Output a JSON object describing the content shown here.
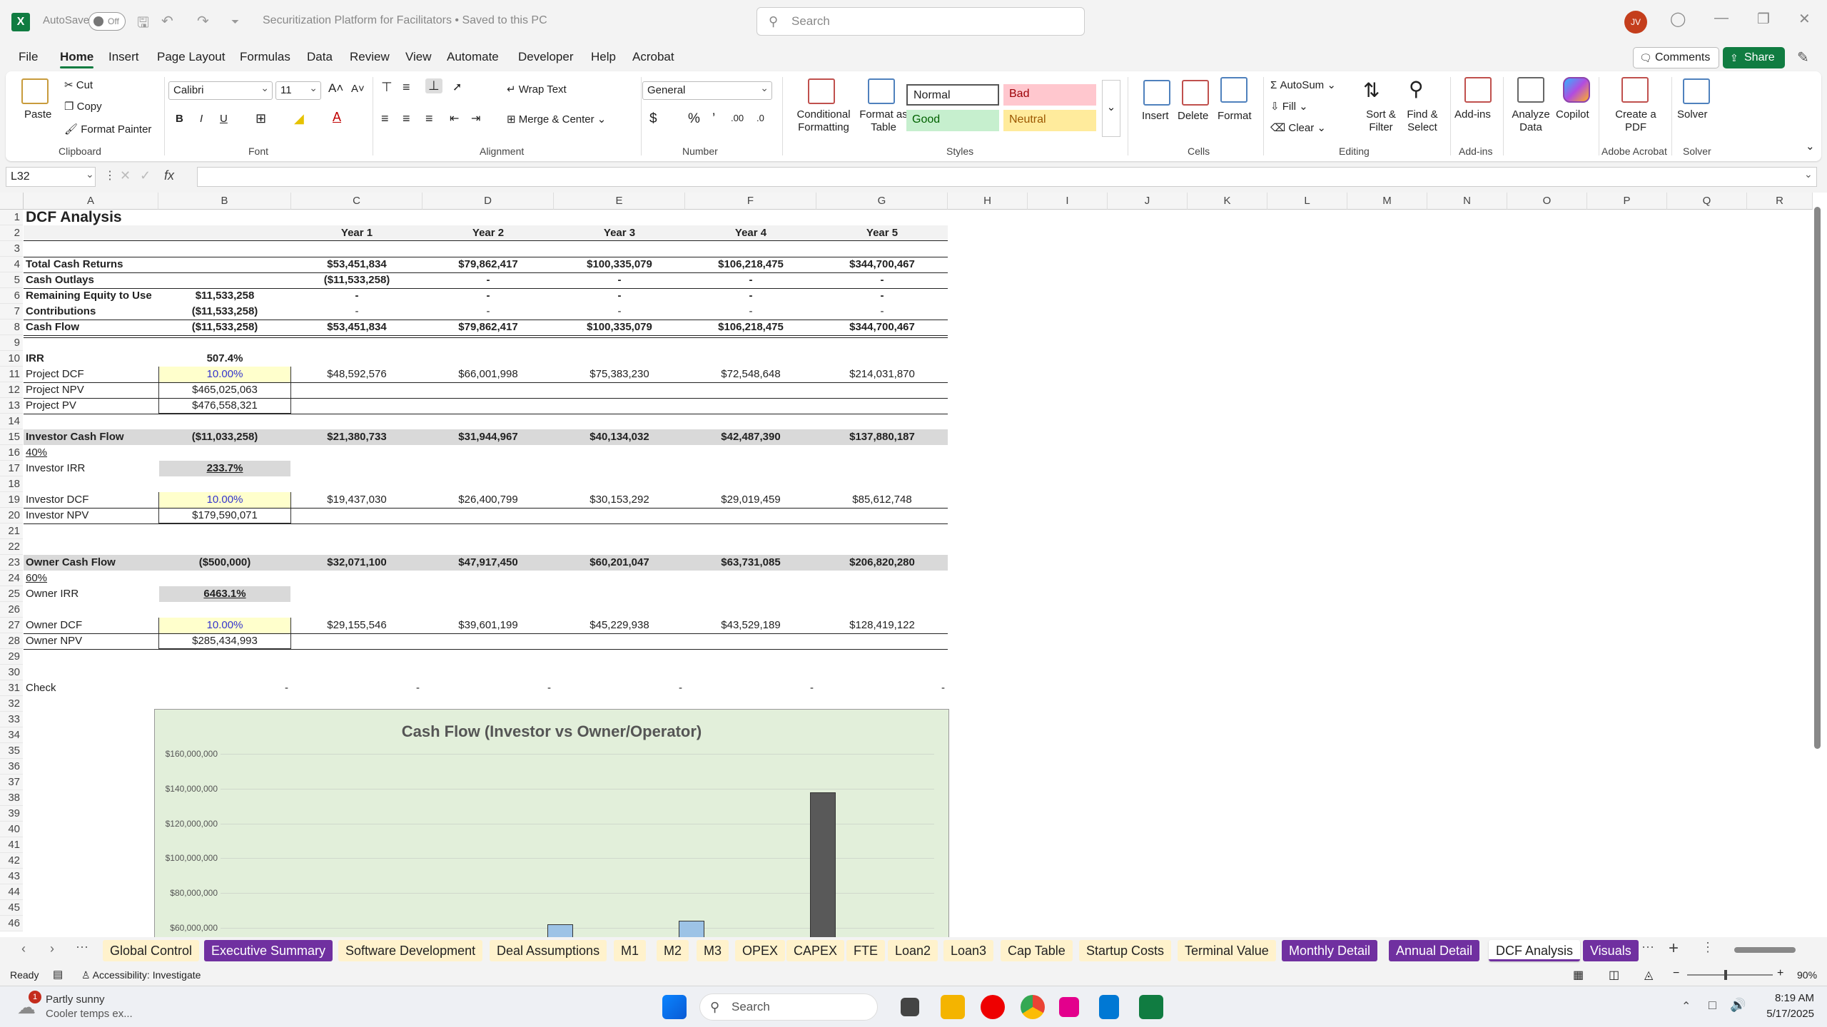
{
  "titlebar": {
    "autosave_label": "AutoSave",
    "autosave_state": "Off",
    "doc_title": "Securitization Platform for Facilitators • Saved to this PC",
    "search_placeholder": "Search",
    "user_initials": "JV"
  },
  "menu": {
    "tabs": [
      "File",
      "Home",
      "Insert",
      "Page Layout",
      "Formulas",
      "Data",
      "Review",
      "View",
      "Automate",
      "Developer",
      "Help",
      "Acrobat"
    ],
    "comments": "Comments",
    "share": "Share"
  },
  "ribbon": {
    "clipboard": {
      "paste": "Paste",
      "cut": "Cut",
      "copy": "Copy",
      "format_painter": "Format Painter",
      "group": "Clipboard"
    },
    "font": {
      "name": "Calibri",
      "size": "11",
      "group": "Font"
    },
    "alignment": {
      "wrap_text": "Wrap Text",
      "merge_center": "Merge & Center",
      "group": "Alignment"
    },
    "number": {
      "format": "General",
      "group": "Number"
    },
    "styles": {
      "conditional": "Conditional Formatting",
      "format_table": "Format as Table",
      "normal": "Normal",
      "bad": "Bad",
      "good": "Good",
      "neutral": "Neutral",
      "group": "Styles"
    },
    "cells": {
      "insert": "Insert",
      "delete": "Delete",
      "format": "Format",
      "group": "Cells"
    },
    "editing": {
      "autosum": "AutoSum",
      "fill": "Fill",
      "clear": "Clear",
      "sort_filter": "Sort & Filter",
      "find_select": "Find & Select",
      "group": "Editing"
    },
    "addins": {
      "addins": "Add-ins",
      "group": "Add-ins"
    },
    "analyze": {
      "label": "Analyze Data"
    },
    "copilot": {
      "label": "Copilot"
    },
    "acrobat": {
      "create_pdf": "Create a PDF",
      "group": "Adobe Acrobat"
    },
    "solver": {
      "label": "Solver",
      "group": "Solver"
    }
  },
  "formula_bar": {
    "name_box": "L32",
    "fx": "fx",
    "formula": ""
  },
  "columns": [
    "A",
    "B",
    "C",
    "D",
    "E",
    "F",
    "G",
    "H",
    "I",
    "J",
    "K",
    "L",
    "M",
    "N",
    "O",
    "P",
    "Q",
    "R"
  ],
  "rows": [
    "1",
    "2",
    "3",
    "4",
    "5",
    "6",
    "7",
    "8",
    "9",
    "10",
    "11",
    "12",
    "13",
    "14",
    "15",
    "16",
    "17",
    "18",
    "19",
    "20",
    "21",
    "22",
    "23",
    "24",
    "25",
    "26",
    "27",
    "28",
    "29",
    "30",
    "31",
    "32",
    "33",
    "34",
    "35",
    "36",
    "37",
    "38",
    "39",
    "40",
    "41",
    "42",
    "43",
    "44",
    "45",
    "46"
  ],
  "sheet": {
    "title": "DCF Analysis",
    "years": [
      "Year 1",
      "Year 2",
      "Year 3",
      "Year 4",
      "Year 5"
    ],
    "total_cash_returns": {
      "label": "Total Cash Returns",
      "values": [
        "$53,451,834",
        "$79,862,417",
        "$100,335,079",
        "$106,218,475",
        "$344,700,467"
      ]
    },
    "cash_outlays": {
      "label": "Cash Outlays",
      "values": [
        "($11,533,258)",
        "-",
        "-",
        "-",
        "-"
      ]
    },
    "remaining_equity": {
      "label": "Remaining Equity to Use",
      "b": "$11,533,258",
      "values": [
        "-",
        "-",
        "-",
        "-",
        "-"
      ]
    },
    "contributions": {
      "label": "Contributions",
      "b": "($11,533,258)",
      "values": [
        "-",
        "-",
        "-",
        "-",
        "-"
      ]
    },
    "cash_flow": {
      "label": "Cash Flow",
      "b": "($11,533,258)",
      "values": [
        "$53,451,834",
        "$79,862,417",
        "$100,335,079",
        "$106,218,475",
        "$344,700,467"
      ]
    },
    "irr": {
      "label": "IRR",
      "b": "507.4%"
    },
    "project_dcf": {
      "label": "Project DCF",
      "b": "10.00%",
      "values": [
        "$48,592,576",
        "$66,001,998",
        "$75,383,230",
        "$72,548,648",
        "$214,031,870"
      ]
    },
    "project_npv": {
      "label": "Project NPV",
      "b": "$465,025,063"
    },
    "project_pv": {
      "label": "Project PV",
      "b": "$476,558,321"
    },
    "investor_cf": {
      "label": "Investor Cash Flow",
      "b": "($11,033,258)",
      "values": [
        "$21,380,733",
        "$31,944,967",
        "$40,134,032",
        "$42,487,390",
        "$137,880,187"
      ]
    },
    "investor_pct": "40%",
    "investor_irr": {
      "label": "Investor IRR",
      "b": "233.7%"
    },
    "investor_dcf": {
      "label": "Investor DCF",
      "b": "10.00%",
      "values": [
        "$19,437,030",
        "$26,400,799",
        "$30,153,292",
        "$29,019,459",
        "$85,612,748"
      ]
    },
    "investor_npv": {
      "label": "Investor NPV",
      "b": "$179,590,071"
    },
    "owner_cf": {
      "label": "Owner Cash Flow",
      "b": "($500,000)",
      "values": [
        "$32,071,100",
        "$47,917,450",
        "$60,201,047",
        "$63,731,085",
        "$206,820,280"
      ]
    },
    "owner_pct": "60%",
    "owner_irr": {
      "label": "Owner IRR",
      "b": "6463.1%"
    },
    "owner_dcf": {
      "label": "Owner DCF",
      "b": "10.00%",
      "values": [
        "$29,155,546",
        "$39,601,199",
        "$45,229,938",
        "$43,529,189",
        "$128,419,122"
      ]
    },
    "owner_npv": {
      "label": "Owner NPV",
      "b": "$285,434,993"
    },
    "check": {
      "label": "Check",
      "values": [
        "-",
        "-",
        "-",
        "-",
        "-",
        "-"
      ]
    }
  },
  "chart_data": {
    "type": "bar",
    "title": "Cash Flow (Investor vs Owner/Operator)",
    "y_tick_labels": [
      "$160,000,000",
      "$140,000,000",
      "$120,000,000",
      "$100,000,000",
      "$80,000,000",
      "$60,000,000"
    ],
    "visible_y_range": [
      60000000,
      160000000
    ],
    "series": [
      {
        "values": [
          null,
          null,
          62000000,
          64000000,
          null
        ],
        "color": "#9dc3e6"
      },
      {
        "values": [
          null,
          null,
          null,
          null,
          137880187
        ],
        "color": "#595959"
      }
    ],
    "note_visible": "chart is cropped at the bottom of the window"
  },
  "sheet_tabs": [
    {
      "label": "Global Control",
      "bg": "#fff2cc",
      "fg": "#222"
    },
    {
      "label": "Executive Summary",
      "bg": "#7030a0",
      "fg": "#fff"
    },
    {
      "label": "Software Development",
      "bg": "#fff2cc",
      "fg": "#222"
    },
    {
      "label": "Deal Assumptions",
      "bg": "#fff2cc",
      "fg": "#222"
    },
    {
      "label": "M1",
      "bg": "#fff2cc",
      "fg": "#222"
    },
    {
      "label": "M2",
      "bg": "#fff2cc",
      "fg": "#222"
    },
    {
      "label": "M3",
      "bg": "#fff2cc",
      "fg": "#222"
    },
    {
      "label": "OPEX",
      "bg": "#fff2cc",
      "fg": "#222"
    },
    {
      "label": "CAPEX",
      "bg": "#fff2cc",
      "fg": "#222"
    },
    {
      "label": "FTE",
      "bg": "#fff2cc",
      "fg": "#222"
    },
    {
      "label": "Loan2",
      "bg": "#fff2cc",
      "fg": "#222"
    },
    {
      "label": "Loan3",
      "bg": "#fff2cc",
      "fg": "#222"
    },
    {
      "label": "Cap Table",
      "bg": "#fff2cc",
      "fg": "#222"
    },
    {
      "label": "Startup Costs",
      "bg": "#fff2cc",
      "fg": "#222"
    },
    {
      "label": "Terminal Value",
      "bg": "#fff2cc",
      "fg": "#222"
    },
    {
      "label": "Monthly Detail",
      "bg": "#7030a0",
      "fg": "#fff"
    },
    {
      "label": "Annual Detail",
      "bg": "#7030a0",
      "fg": "#fff"
    },
    {
      "label": "DCF Analysis",
      "bg": "#ffffff",
      "fg": "#222"
    },
    {
      "label": "Visuals",
      "bg": "#7030a0",
      "fg": "#fff"
    }
  ],
  "status": {
    "ready": "Ready",
    "accessibility": "Accessibility: Investigate",
    "zoom": "90%"
  },
  "taskbar": {
    "weather_line1": "Partly sunny",
    "weather_line2": "Cooler temps ex...",
    "search": "Search",
    "time": "8:19 AM",
    "date": "5/17/2025",
    "notif": "1"
  }
}
